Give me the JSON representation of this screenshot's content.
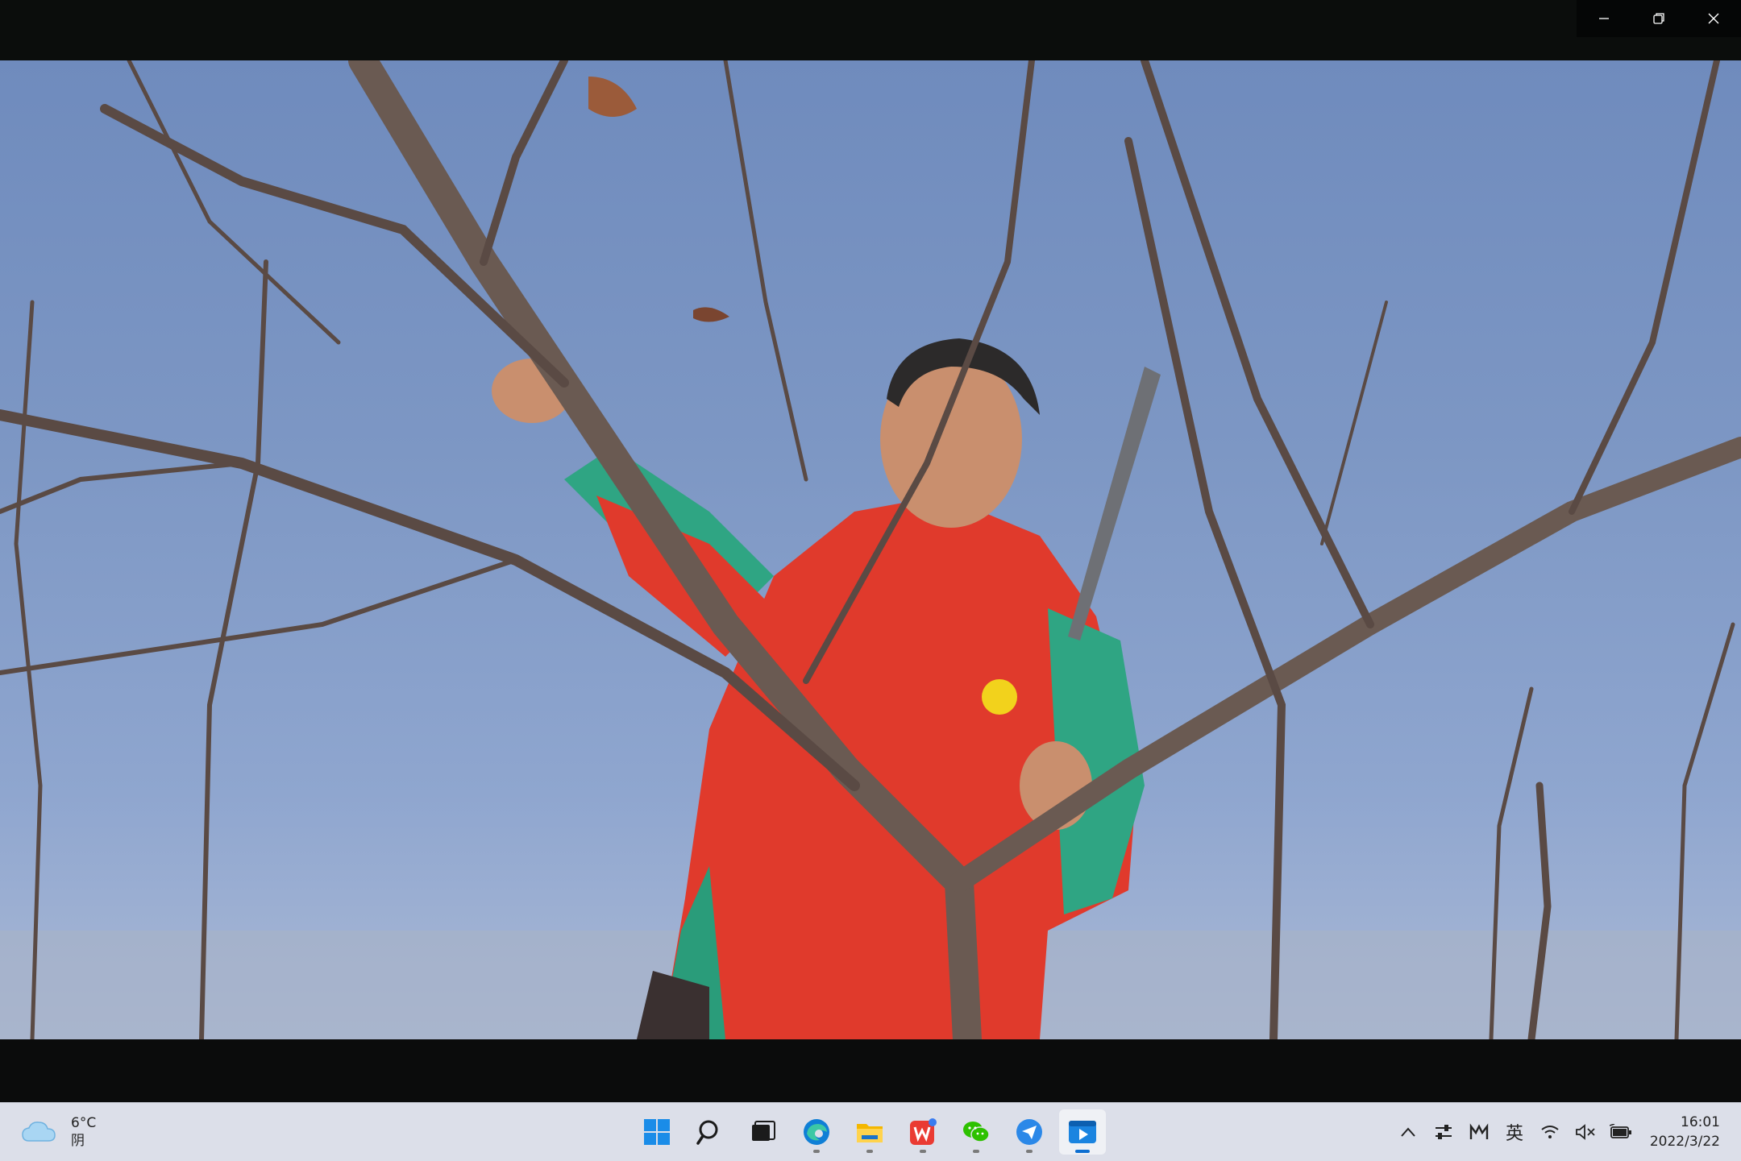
{
  "window": {
    "controls": {
      "minimize": "minimize-icon",
      "restore": "restore-icon",
      "close": "close-icon"
    }
  },
  "video": {
    "content": "man pruning a bare fruit tree against a blue sky"
  },
  "taskbar": {
    "weather": {
      "temperature": "6°C",
      "condition": "阴",
      "icon": "cloud-icon"
    },
    "apps": [
      {
        "name": "start",
        "icon": "windows-logo-icon"
      },
      {
        "name": "search",
        "icon": "search-icon"
      },
      {
        "name": "task-view",
        "icon": "task-view-icon"
      },
      {
        "name": "edge",
        "icon": "edge-icon"
      },
      {
        "name": "file-explorer",
        "icon": "folder-icon"
      },
      {
        "name": "wps",
        "icon": "wps-icon"
      },
      {
        "name": "wechat",
        "icon": "wechat-icon"
      },
      {
        "name": "feishu",
        "icon": "paper-plane-icon"
      },
      {
        "name": "media-player",
        "icon": "media-player-icon"
      }
    ],
    "tray": {
      "overflow": "chevron-up-icon",
      "input_method": "英",
      "icons": [
        "settings-sliders-icon",
        "pen-icon",
        "wifi-icon",
        "volume-muted-icon",
        "battery-icon"
      ]
    },
    "clock": {
      "time": "16:01",
      "date": "2022/3/22"
    }
  }
}
